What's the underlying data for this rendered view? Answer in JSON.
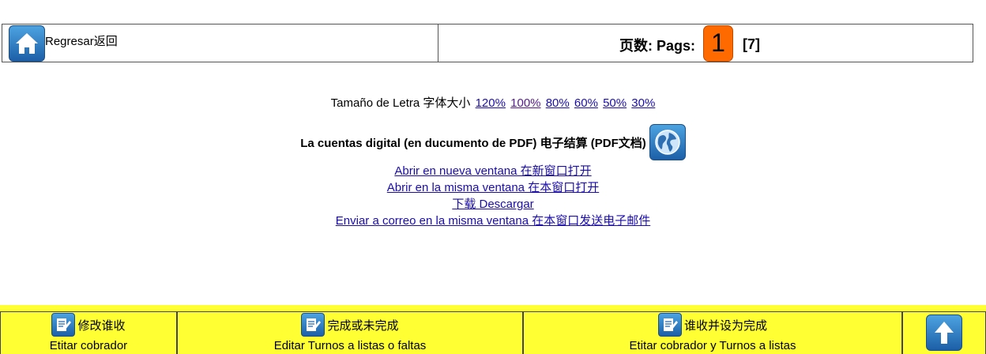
{
  "header": {
    "back_label": "Regresar返回",
    "pages_label": "页数: Pags:",
    "current_page": "1",
    "total_pages": "[7]",
    "home_icon": "home-icon",
    "page_badge_color": "#ff6a00"
  },
  "font_size": {
    "label": "Tamaño de Letra 字体大小",
    "options": [
      "120%",
      "100%",
      "80%",
      "60%",
      "50%",
      "30%"
    ]
  },
  "pdf": {
    "title": "La cuentas digital (en ducumento de PDF) 电子结算 (PDF文档)",
    "icon": "globe-icon",
    "links": [
      "Abrir en nueva ventana 在新窗口打开",
      "Abrir en la misma ventana 在本窗口打开",
      "下载 Descargar",
      "Enviar a correo en la misma ventana 在本窗口发送电子邮件"
    ]
  },
  "toolbar": {
    "background": "#ffff33",
    "items": [
      {
        "top_label": "修改谁收",
        "bottom_label": "Etitar cobrador",
        "icon": "edit-icon"
      },
      {
        "top_label": "完成或未完成",
        "bottom_label": "Editar Turnos a listas o faltas",
        "icon": "edit-icon"
      },
      {
        "top_label": "谁收并设为完成",
        "bottom_label": "Etitar cobrador y Turnos a listas",
        "icon": "edit-icon"
      }
    ],
    "up_icon": "arrow-up-icon"
  }
}
